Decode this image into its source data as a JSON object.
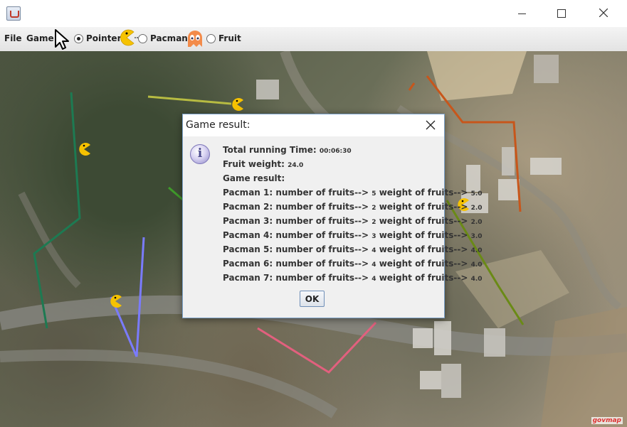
{
  "window": {
    "icon": "java-cup-icon",
    "controls": [
      "minimize-icon",
      "maximize-icon",
      "close-icon"
    ]
  },
  "menu": {
    "file": "File",
    "game": "Game"
  },
  "modes": {
    "pointer": "Pointer",
    "pacman": "Pacman",
    "fruit": "Fruit",
    "selected": "Pointer"
  },
  "colors": {
    "pacman": "#f6c200",
    "ghost": "#f38b4a",
    "path_green": "#1d7a52",
    "path_olive": "#6a8a16",
    "path_blue": "#7a7bff",
    "path_orange": "#c7561b",
    "path_pink": "#e2607e",
    "path_khaki": "#b7bb42"
  },
  "dialog": {
    "title": "Game result:",
    "total_time_label": "Total running Time: ",
    "total_time_value": "00:06:30",
    "fruit_weight_label": "Fruit weight: ",
    "fruit_weight_value": "24.0",
    "game_result_label": "Game result:",
    "results": [
      {
        "label": "Pacman 1: number of fruits--> ",
        "fruits": "5",
        "mid": " weight of fruits--> ",
        "weight": "5.0"
      },
      {
        "label": "Pacman 2: number of fruits--> ",
        "fruits": "2",
        "mid": " weight of fruits--> ",
        "weight": "2.0"
      },
      {
        "label": "Pacman 3: number of fruits--> ",
        "fruits": "2",
        "mid": " weight of fruits--> ",
        "weight": "2.0"
      },
      {
        "label": "Pacman 4: number of fruits--> ",
        "fruits": "3",
        "mid": " weight of fruits--> ",
        "weight": "3.0"
      },
      {
        "label": "Pacman 5: number of fruits--> ",
        "fruits": "4",
        "mid": " weight of fruits--> ",
        "weight": "4.0"
      },
      {
        "label": "Pacman 6: number of fruits--> ",
        "fruits": "4",
        "mid": " weight of fruits--> ",
        "weight": "4.0"
      },
      {
        "label": "Pacman 7: number of fruits--> ",
        "fruits": "4",
        "mid": " weight of fruits--> ",
        "weight": "4.0"
      }
    ],
    "ok": "OK"
  },
  "map": {
    "attribution": "govmap"
  }
}
